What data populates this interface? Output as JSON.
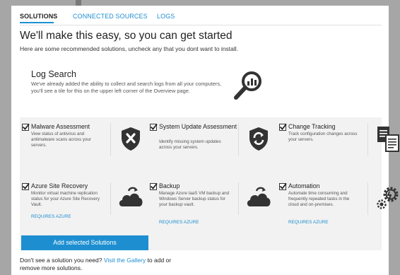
{
  "tabs": [
    {
      "label": "SOLUTIONS"
    },
    {
      "label": "CONNECTED SOURCES"
    },
    {
      "label": "LOGS"
    }
  ],
  "headline": "We'll make this easy, so you can get started",
  "subhead": "Here are some recommended solutions, uncheck any that you dont want to install.",
  "featured": {
    "title": "Log Search",
    "description": "We've already added the ability to collect and search logs from all your computers, you'll see a tile for this on the upper left corner of the Overview page.",
    "icon": "magnifier-chart-icon"
  },
  "solutions": [
    {
      "title": "Malware Assessment",
      "description": "View status of antivirus and antimalware scans across your servers.",
      "checked": true,
      "icon": "shield-x-icon",
      "requires": ""
    },
    {
      "title": "System Update Assessment",
      "description": "Identify missing system updates across your servers.",
      "checked": true,
      "icon": "shield-refresh-icon",
      "requires": ""
    },
    {
      "title": "Change Tracking",
      "description": "Track configuration changes across your servers.",
      "checked": true,
      "icon": "document-compare-icon",
      "requires": ""
    },
    {
      "title": "Azure Site Recovery",
      "description": "Monitor virtual machine replication status for your Azure Site Recovery Vault.",
      "checked": true,
      "icon": "cloud-recovery-icon",
      "requires": "REQUIRES AZURE"
    },
    {
      "title": "Backup",
      "description": "Manage Azure IaaS VM backup and Windows Server backup status for your backup vault.",
      "checked": true,
      "icon": "cloud-backup-icon",
      "requires": "REQUIRES AZURE"
    },
    {
      "title": "Automation",
      "description": "Automate time consuming and frequently repeated tasks in the cloud and on-premises.",
      "checked": true,
      "icon": "gears-icon",
      "requires": "REQUIRES AZURE"
    }
  ],
  "add_button": "Add selected Solutions",
  "footer": {
    "prefix": "Don't see a solution you need? ",
    "link": "Visit the Gallery",
    "suffix": " to add or remove more solutions."
  },
  "colors": {
    "accent": "#1d8fd1",
    "icon": "#333333",
    "panel_bg": "#f2f2f2"
  }
}
